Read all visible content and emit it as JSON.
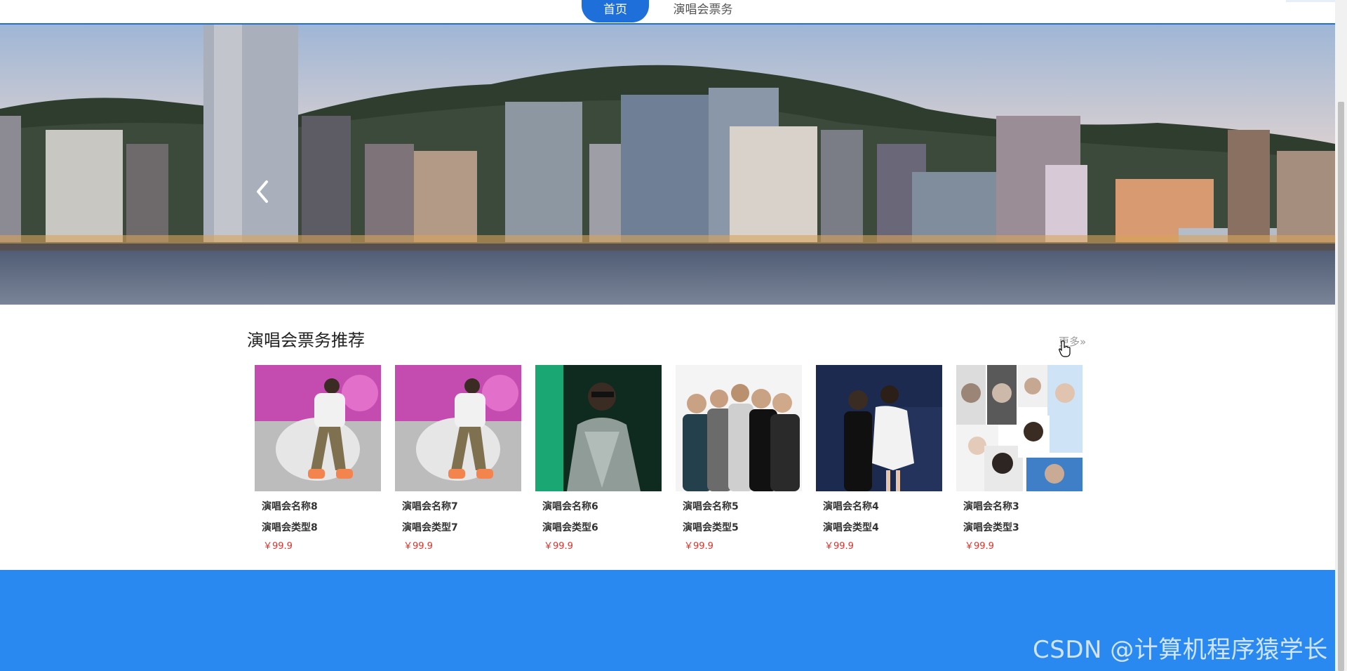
{
  "nav": {
    "items": [
      {
        "label": "首页",
        "active": true
      },
      {
        "label": "演唱会票务",
        "active": false
      }
    ],
    "accent_color": "#1e6fd9"
  },
  "banner": {
    "prev_icon": "chevron-left-icon",
    "slide_count": 3,
    "active_slide": 3
  },
  "section": {
    "title": "演唱会票务推荐",
    "more_label": "更多»"
  },
  "cards": [
    {
      "name": "演唱会名称8",
      "type": "演唱会类型8",
      "price": "￥99.9",
      "image": "rapper-performing-stage-photo"
    },
    {
      "name": "演唱会名称7",
      "type": "演唱会类型7",
      "price": "￥99.9",
      "image": "rapper-performing-stage-photo"
    },
    {
      "name": "演唱会名称6",
      "type": "演唱会类型6",
      "price": "￥99.9",
      "image": "singer-silver-jacket-photo"
    },
    {
      "name": "演唱会名称5",
      "type": "演唱会类型5",
      "price": "￥99.9",
      "image": "band-group-photo"
    },
    {
      "name": "演唱会名称4",
      "type": "演唱会类型4",
      "price": "￥99.9",
      "image": "duet-singers-stage-photo"
    },
    {
      "name": "演唱会名称3",
      "type": "演唱会类型3",
      "price": "￥99.9",
      "image": "portrait-collage-photo"
    }
  ],
  "price_color": "#e0322c",
  "footer_color": "#2a89f0",
  "watermark": "CSDN @计算机程序猿学长"
}
